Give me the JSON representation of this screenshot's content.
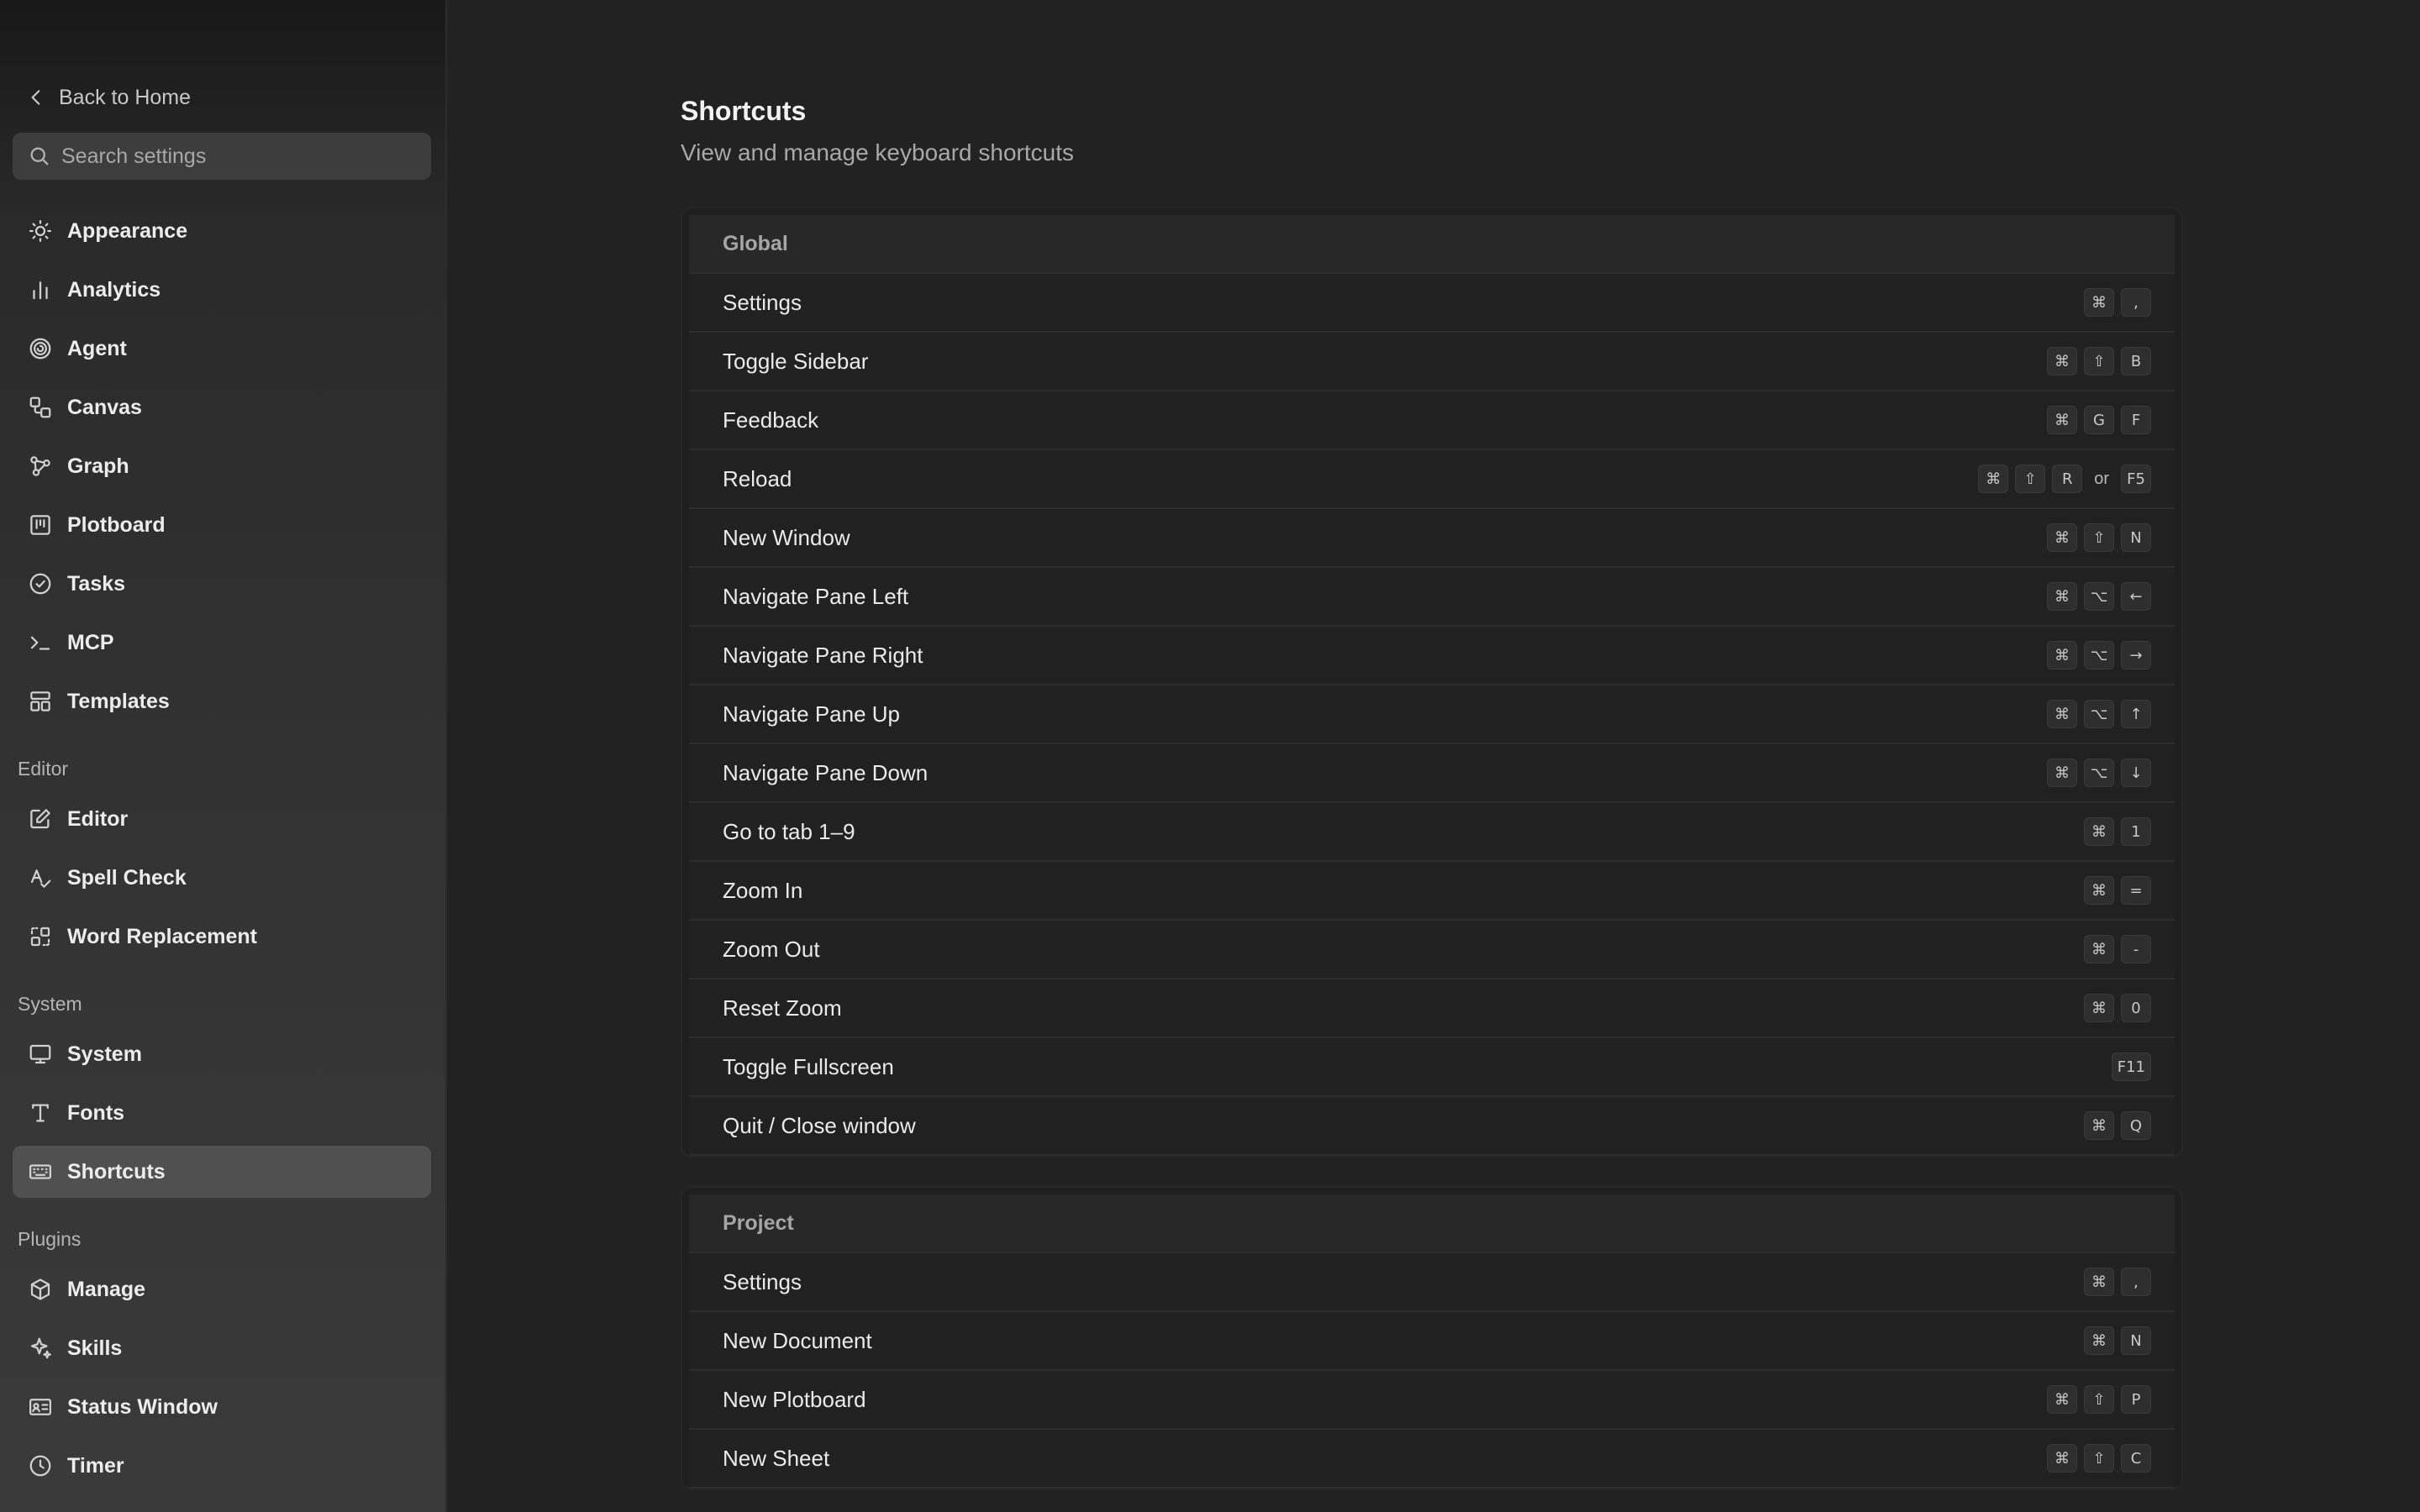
{
  "sidebar": {
    "back_label": "Back to Home",
    "search_placeholder": "Search settings",
    "items": [
      {
        "label": "Appearance",
        "icon": "sun-icon",
        "top": 0
      },
      {
        "label": "Analytics",
        "icon": "bar-chart-icon"
      },
      {
        "label": "Agent",
        "icon": "spiral-icon"
      },
      {
        "label": "Canvas",
        "icon": "shapes-icon"
      },
      {
        "label": "Graph",
        "icon": "graph-nodes-icon"
      },
      {
        "label": "Plotboard",
        "icon": "kanban-icon"
      },
      {
        "label": "Tasks",
        "icon": "check-circle-icon"
      },
      {
        "label": "MCP",
        "icon": "terminal-icon"
      },
      {
        "label": "Templates",
        "icon": "layout-icon"
      }
    ],
    "sections": [
      {
        "label": "Editor",
        "items": [
          {
            "label": "Editor",
            "icon": "pencil-square-icon"
          },
          {
            "label": "Spell Check",
            "icon": "spell-check-icon"
          },
          {
            "label": "Word Replacement",
            "icon": "replace-icon"
          }
        ]
      },
      {
        "label": "System",
        "items": [
          {
            "label": "System",
            "icon": "monitor-icon"
          },
          {
            "label": "Fonts",
            "icon": "type-icon"
          },
          {
            "label": "Shortcuts",
            "icon": "keyboard-icon",
            "active": true
          }
        ]
      },
      {
        "label": "Plugins",
        "items": [
          {
            "label": "Manage",
            "icon": "package-icon"
          },
          {
            "label": "Skills",
            "icon": "sparkle-icon"
          },
          {
            "label": "Status Window",
            "icon": "id-card-icon"
          },
          {
            "label": "Timer",
            "icon": "clock-icon"
          }
        ]
      }
    ]
  },
  "main": {
    "title": "Shortcuts",
    "subtitle": "View and manage keyboard shortcuts",
    "groups": [
      {
        "name": "Global",
        "rows": [
          {
            "label": "Settings",
            "keys": [
              "⌘",
              ","
            ]
          },
          {
            "label": "Toggle Sidebar",
            "keys": [
              "⌘",
              "⇧",
              "B"
            ]
          },
          {
            "label": "Feedback",
            "keys": [
              "⌘",
              "G",
              "F"
            ]
          },
          {
            "label": "Reload",
            "keys": [
              "⌘",
              "⇧",
              "R"
            ],
            "alt_word": "or",
            "alt_keys": [
              "F5"
            ]
          },
          {
            "label": "New Window",
            "keys": [
              "⌘",
              "⇧",
              "N"
            ]
          },
          {
            "label": "Navigate Pane Left",
            "keys": [
              "⌘",
              "⌥",
              "←"
            ]
          },
          {
            "label": "Navigate Pane Right",
            "keys": [
              "⌘",
              "⌥",
              "→"
            ]
          },
          {
            "label": "Navigate Pane Up",
            "keys": [
              "⌘",
              "⌥",
              "↑"
            ]
          },
          {
            "label": "Navigate Pane Down",
            "keys": [
              "⌘",
              "⌥",
              "↓"
            ]
          },
          {
            "label": "Go to tab 1–9",
            "keys": [
              "⌘",
              "1"
            ]
          },
          {
            "label": "Zoom In",
            "keys": [
              "⌘",
              "="
            ]
          },
          {
            "label": "Zoom Out",
            "keys": [
              "⌘",
              "-"
            ]
          },
          {
            "label": "Reset Zoom",
            "keys": [
              "⌘",
              "0"
            ]
          },
          {
            "label": "Toggle Fullscreen",
            "keys": [
              "F11"
            ]
          },
          {
            "label": "Quit / Close window",
            "keys": [
              "⌘",
              "Q"
            ]
          }
        ]
      },
      {
        "name": "Project",
        "rows": [
          {
            "label": "Settings",
            "keys": [
              "⌘",
              ","
            ]
          },
          {
            "label": "New Document",
            "keys": [
              "⌘",
              "N"
            ]
          },
          {
            "label": "New Plotboard",
            "keys": [
              "⌘",
              "⇧",
              "P"
            ]
          },
          {
            "label": "New Sheet",
            "keys": [
              "⌘",
              "⇧",
              "C"
            ]
          }
        ]
      }
    ]
  }
}
